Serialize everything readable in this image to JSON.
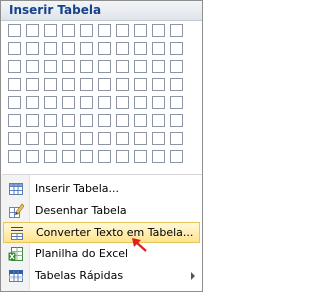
{
  "header": {
    "title": "Inserir Tabela"
  },
  "grid": {
    "columns": 10,
    "rows": 8
  },
  "menu_items": [
    {
      "label": "Inserir Tabela...",
      "icon": "insert-table-icon"
    },
    {
      "label": "Desenhar Tabela",
      "icon": "draw-table-icon"
    },
    {
      "label": "Converter Texto em Tabela...",
      "icon": "convert-text-to-table-icon",
      "highlighted": true
    },
    {
      "label": "Planilha do Excel",
      "icon": "excel-spreadsheet-icon"
    },
    {
      "label": "Tabelas Rápidas",
      "icon": "quick-tables-icon",
      "has_submenu": true
    }
  ],
  "colors": {
    "header_text": "#15428b",
    "highlight_bg": "#ffe38e",
    "highlight_border": "#e7c55a",
    "pointer": "#e02020"
  }
}
